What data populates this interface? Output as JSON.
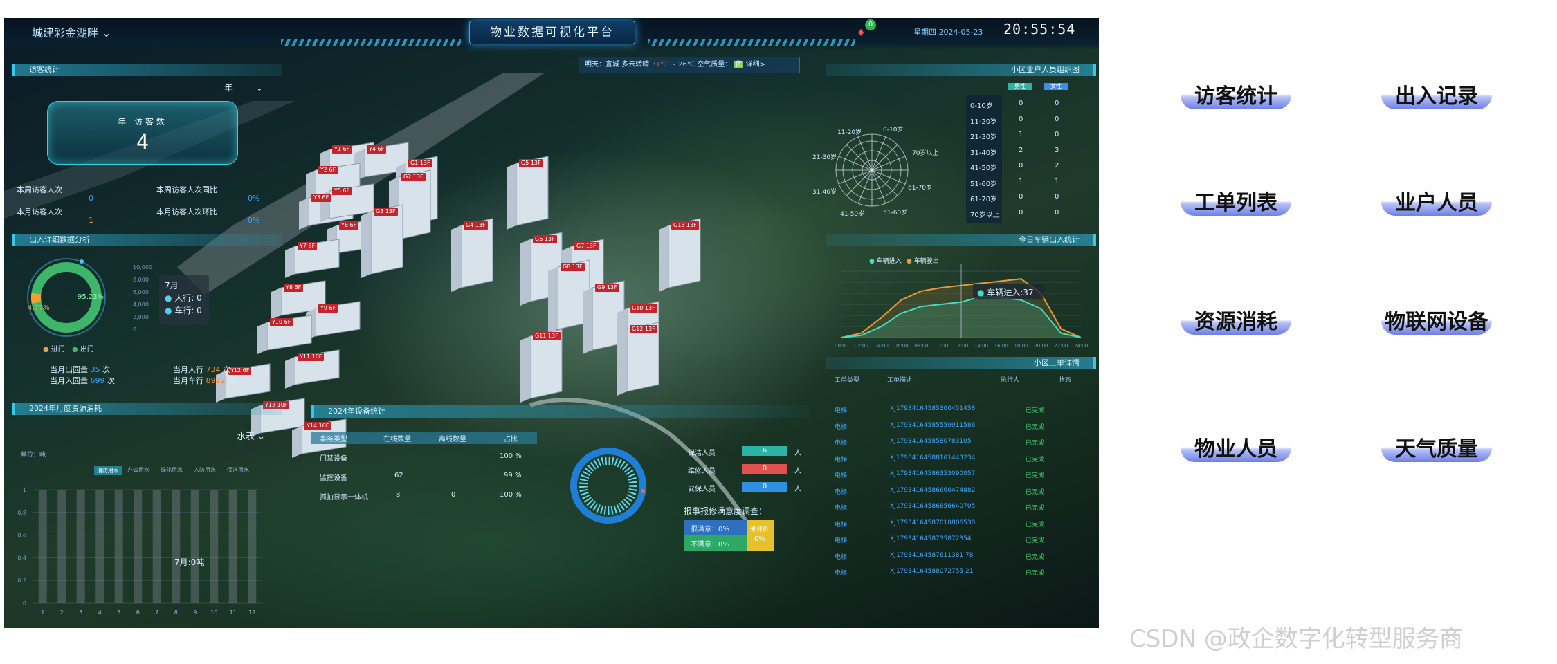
{
  "header": {
    "brand": "城建彩金湖畔",
    "title": "物业数据可视化平台",
    "notification_count": "0",
    "date": "星期四 2024-05-23",
    "time": "20:55:54"
  },
  "weather": {
    "text": "明天：宣城  多云转晴",
    "temp_low": "31℃",
    "temp_rest": "~ 26℃ 空气质量：",
    "aqi": "优",
    "detail": "详细>"
  },
  "visitor_stats": {
    "header": "访客统计",
    "period": "年",
    "box_label": "年 访客数",
    "box_value": "4",
    "rows": [
      {
        "label": "本周访客人次",
        "value": "0"
      },
      {
        "label": "本月访客人次",
        "value": "1"
      }
    ],
    "compare": [
      {
        "label": "本周访客人次同比",
        "value": "0%"
      },
      {
        "label": "本月访客人次环比",
        "value": "0%"
      }
    ]
  },
  "access_analysis": {
    "header": "出入详细数据分析",
    "ring_in_pct": "4.77%",
    "ring_out_pct": "95.23%",
    "legend_in": "进门",
    "legend_out": "出门",
    "month_label": "7月",
    "pedestrian": "人行: 0",
    "vehicle": "车行: 0",
    "stats": [
      {
        "label": "当月出园量",
        "value": "35",
        "unit": "次"
      },
      {
        "label": "当月入园量",
        "value": "699",
        "unit": "次"
      },
      {
        "label": "当月人行",
        "value": "734",
        "unit": "次"
      },
      {
        "label": "当月车行",
        "value": "8922",
        "unit": "次"
      }
    ],
    "y_ticks": [
      "10,000",
      "8,000",
      "6,000",
      "4,000",
      "2,000",
      "0"
    ]
  },
  "resource": {
    "header": "2024年月度资源消耗",
    "meter": "水表",
    "unit": "单位：吨",
    "tabs": [
      "消防用水",
      "办公用水",
      "绿化用水",
      "人防用水",
      "保洁用水"
    ],
    "tooltip": "7月:0吨",
    "y_ticks": [
      "1",
      "0.8",
      "0.6",
      "0.4",
      "0.2",
      "0"
    ],
    "months": [
      "1",
      "2",
      "3",
      "4",
      "5",
      "6",
      "7",
      "8",
      "9",
      "10",
      "11",
      "12"
    ]
  },
  "chart_data": [
    {
      "type": "pie",
      "title": "出入详细数据分析",
      "categories": [
        "进门",
        "出门"
      ],
      "values": [
        4.77,
        95.23
      ]
    },
    {
      "type": "bar",
      "title": "2024年月度资源消耗",
      "ylabel": "单位：吨",
      "categories": [
        "1",
        "2",
        "3",
        "4",
        "5",
        "6",
        "7",
        "8",
        "9",
        "10",
        "11",
        "12"
      ],
      "values": [
        0,
        0,
        0,
        0,
        0,
        0,
        0,
        0,
        0,
        0,
        0,
        0
      ],
      "ylim": [
        0,
        1
      ]
    },
    {
      "type": "line",
      "title": "今日车辆出入统计",
      "series": [
        {
          "name": "车辆进入",
          "values": [
            0,
            2,
            10,
            22,
            28,
            30,
            32,
            37,
            36,
            34,
            26,
            4,
            0
          ]
        },
        {
          "name": "车辆驶出",
          "values": [
            0,
            4,
            18,
            34,
            42,
            45,
            47,
            49,
            51,
            53,
            40,
            8,
            0
          ]
        }
      ],
      "x": [
        "00:00",
        "02:00",
        "04:00",
        "06:00",
        "08:00",
        "10:00",
        "12:00",
        "14:00",
        "16:00",
        "18:00",
        "20:00",
        "22:00",
        "24:00"
      ],
      "ylim": [
        0,
        60
      ]
    }
  ],
  "equipment": {
    "header": "2024年设备统计",
    "columns": [
      "事务类型",
      "在线数量",
      "离线数量",
      "占比"
    ],
    "rows": [
      {
        "type": "门禁设备",
        "online": "",
        "offline": "",
        "pct": "100 %"
      },
      {
        "type": "监控设备",
        "online": "62",
        "offline": "",
        "pct": "99 %"
      },
      {
        "type": "抓拍显示一体机",
        "online": "8",
        "offline": "0",
        "pct": "100 %"
      }
    ]
  },
  "staff": {
    "rows": [
      {
        "label": "保洁人员",
        "value": "6",
        "unit": "人",
        "color": "#2cb3a8"
      },
      {
        "label": "维修人员",
        "value": "0",
        "unit": "人",
        "color": "#e0504e"
      },
      {
        "label": "安保人员",
        "value": "0",
        "unit": "人",
        "color": "#2f8fe0"
      }
    ]
  },
  "satisfaction": {
    "title": "报事报修满意度调查：",
    "very": "很满意：0%",
    "unhappy": "不满意：0%",
    "pending_label": "未评价",
    "pending": "0%"
  },
  "age_chart": {
    "header": "小区业户人员组织图",
    "male": "男性",
    "female": "女性",
    "radar_labels": [
      "0-10岁",
      "70岁以上",
      "61-70岁",
      "51-60岁",
      "41-50岁",
      "31-40岁",
      "21-30岁",
      "11-20岁"
    ],
    "rows": [
      {
        "age": "0-10岁",
        "m": "0",
        "f": "0"
      },
      {
        "age": "11-20岁",
        "m": "0",
        "f": "0"
      },
      {
        "age": "21-30岁",
        "m": "1",
        "f": "0"
      },
      {
        "age": "31-40岁",
        "m": "2",
        "f": "3"
      },
      {
        "age": "41-50岁",
        "m": "0",
        "f": "2"
      },
      {
        "age": "51-60岁",
        "m": "1",
        "f": "1"
      },
      {
        "age": "61-70岁",
        "m": "0",
        "f": "0"
      },
      {
        "age": "70岁以上",
        "m": "0",
        "f": "0"
      }
    ]
  },
  "vehicle_chart": {
    "header": "今日车辆出入统计",
    "legend_in": "车辆进入",
    "legend_out": "车辆驶出",
    "tooltip": "车辆进入:37"
  },
  "work_orders": {
    "header": "小区工单详情",
    "columns": [
      "工单类型",
      "工单描述",
      "执行人",
      "状态"
    ],
    "rows": [
      {
        "type": "电梯",
        "id": "XJ17934164585300451458",
        "status": "已完成"
      },
      {
        "type": "电梯",
        "id": "XJ17934164585559911586",
        "status": "已完成"
      },
      {
        "type": "电梯",
        "id": "XJ1793416458580783105",
        "status": "已完成"
      },
      {
        "type": "电梯",
        "id": "XJ17934164588101443234",
        "status": "已完成"
      },
      {
        "type": "电梯",
        "id": "XJ17934164586353090057",
        "status": "已完成"
      },
      {
        "type": "电梯",
        "id": "XJ17934164586660474882",
        "status": "已完成"
      },
      {
        "type": "电梯",
        "id": "XJ17934164586856640705",
        "status": "已完成"
      },
      {
        "type": "电梯",
        "id": "XJ17934164587010806530",
        "status": "已完成"
      },
      {
        "type": "电梯",
        "id": "XJ1793416458735872354",
        "status": "已完成"
      },
      {
        "type": "电梯",
        "id": "XJ17934164587611381 78",
        "status": "已完成"
      },
      {
        "type": "电梯",
        "id": "XJ17934164588072755 21",
        "status": "已完成"
      }
    ]
  },
  "buildings": [
    "Y1 6F",
    "Y4 6F",
    "Y2 6F",
    "Y3 6F",
    "Y5 6F",
    "G1 13F",
    "Y6 6F",
    "Y7 6F",
    "G2 13F",
    "Y8 6F",
    "G3 13F",
    "Y9 6F",
    "G4 13F",
    "G5 13F",
    "G6 13F",
    "G7 13F",
    "G8 13F",
    "G9 13F",
    "G10 13F",
    "Y10 6F",
    "Y11 10F",
    "Y12 6F",
    "Y13 10F",
    "Y14 10F",
    "G11 13F",
    "G12 13F",
    "G13 13F"
  ],
  "menu": {
    "items": [
      "访客统计",
      "出入记录",
      "工单列表",
      "业户人员",
      "资源消耗",
      "物联网设备",
      "物业人员",
      "天气质量"
    ]
  },
  "watermark": "CSDN @政企数字化转型服务商",
  "colors": {
    "accent": "#35c8ea",
    "brand_blue": "#6d7fe8",
    "alarm": "#c0262c"
  }
}
